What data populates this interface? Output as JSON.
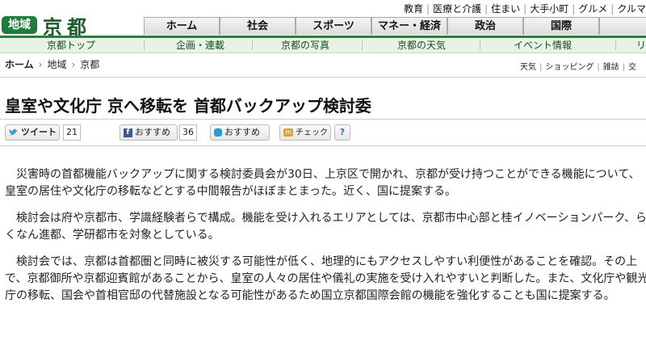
{
  "util_links": [
    "教育",
    "医療と介護",
    "住まい",
    "大手小町",
    "グルメ",
    "クルマ"
  ],
  "region": {
    "badge": "地域",
    "title": "京都"
  },
  "main_nav": [
    "ホーム",
    "社会",
    "スポーツ",
    "マネー・経済",
    "政治",
    "国際",
    ""
  ],
  "sub_nav": [
    "京都トップ",
    "企画・連載",
    "京都の写真",
    "京都の天気",
    "イベント情報",
    "リ"
  ],
  "breadcrumb": {
    "home": "ホーム",
    "items": [
      "地域",
      "京都"
    ],
    "arrow": "›"
  },
  "right_links": [
    "天気",
    "ショッピング",
    "雑誌",
    "交"
  ],
  "headline": "皇室や文化庁 京へ移転を 首都バックアップ検討委",
  "social": {
    "tweet_label": "ツイート",
    "tweet_count": "21",
    "fb_label": "おすすめ",
    "fb_count": "36",
    "mixi_label": "おすすめ",
    "check_label": "チェック",
    "help_label": "?"
  },
  "colors": {
    "accent_green": "#2e7d3c",
    "badge_green": "#1f7d3a",
    "title_green": "#1a5c2a"
  },
  "article": [
    "災害時の首都機能バックアップに関する検討委員会が30日、上京区で開かれ、京都が受け持つことができる機能について、皇室の居住や文化庁の移転などとする中間報告がほぼまとまった。近く、国に提案する。",
    "検討会は府や京都市、学識経験者らで構成。機能を受け入れるエリアとしては、京都市中心部と桂イノベーションパーク、らくなん進都、学研都市を対象としている。",
    "検討会では、京都は首都圏と同時に被災する可能性が低く、地理的にもアクセスしやすい利便性があることを確認。その上で、京都御所や京都迎賓館があることから、皇室の人々の居住や儀礼の実施を受け入れやすいと判断した。また、文化庁や観光庁の移転、国会や首相官邸の代替施設となる可能性があるため国立京都国際会館の機能を強化することも国に提案する。"
  ]
}
